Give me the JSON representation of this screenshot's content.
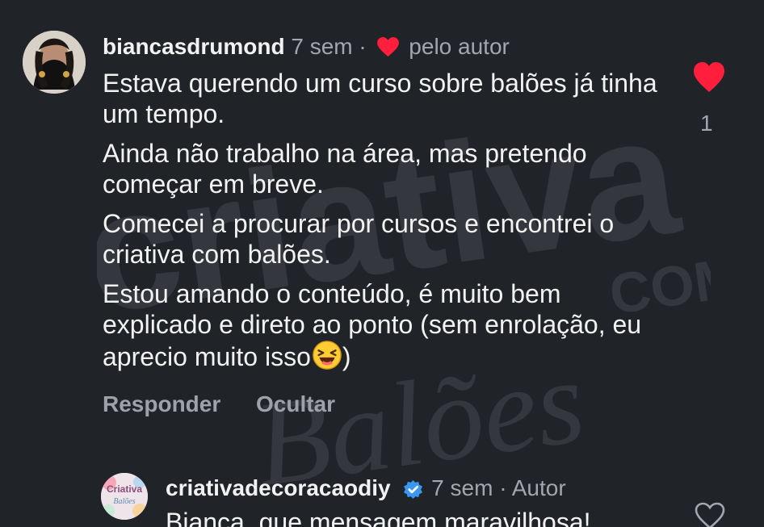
{
  "colors": {
    "background": "#202328",
    "text": "#f2f2f2",
    "muted": "#a3a7ad",
    "heart": "#ff1f3d",
    "verified": "#3897f0"
  },
  "main_comment": {
    "username": "biancasdrumond",
    "time": "7 sem",
    "separator": "·",
    "liked_by_author": "pelo autor",
    "lines": [
      "Estava querendo um curso sobre balões já tinha um tempo.",
      "Ainda não trabalho na área, mas pretendo começar em breve.",
      "Comecei a procurar por cursos e encontrei o criativa com balões.",
      "Estou amando o conteúdo, é muito bem explicado e direto ao ponto (sem enrolação, eu aprecio muito isso"
    ],
    "closing_paren": ")",
    "like_count": "1",
    "reply_label": "Responder",
    "hide_label": "Ocultar"
  },
  "reply_comment": {
    "username": "criativadecoracaodiy",
    "time": "7 sem",
    "separator": "·",
    "author_badge": "Autor",
    "text_preview": "Bianca, que mensagem maravilhosa!"
  },
  "watermark_text": {
    "top": "criativa",
    "middle": "COM",
    "bottom": "Balões"
  },
  "icons": {
    "liked": "heart-filled-icon",
    "reply_like": "heart-outline-icon",
    "verified": "verified-badge-icon",
    "emoji": "laughing-face-emoji-icon"
  }
}
